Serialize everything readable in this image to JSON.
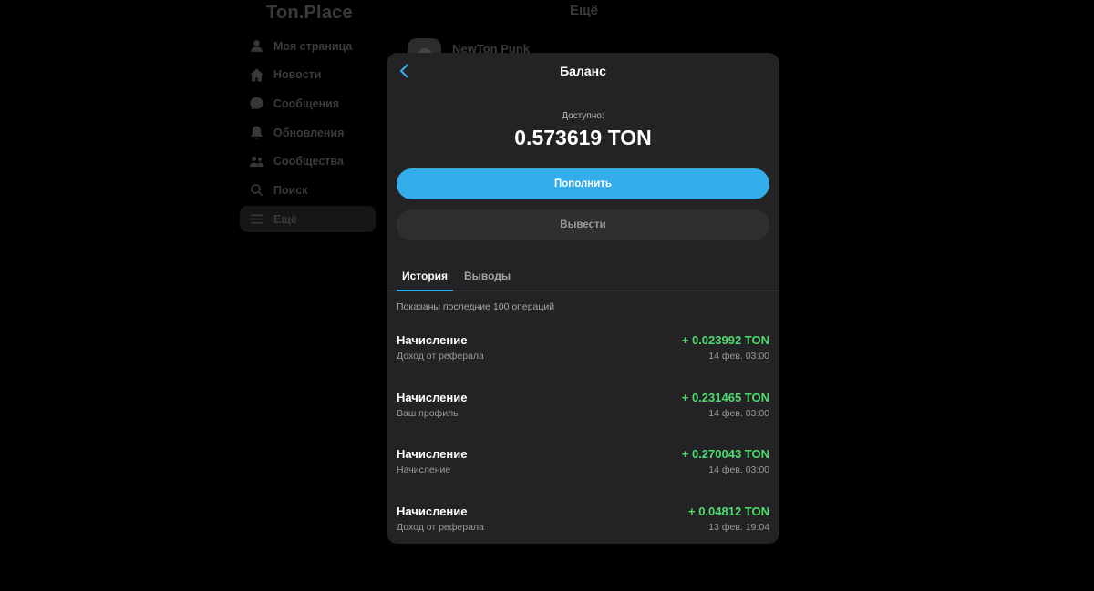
{
  "app": {
    "logo": "Ton.Place",
    "page_title": "Ещё"
  },
  "sidebar": {
    "items": [
      {
        "label": "Моя страница",
        "icon": "user-icon"
      },
      {
        "label": "Новости",
        "icon": "home-icon"
      },
      {
        "label": "Сообщения",
        "icon": "chat-icon"
      },
      {
        "label": "Обновления",
        "icon": "bell-icon"
      },
      {
        "label": "Сообщества",
        "icon": "community-icon"
      },
      {
        "label": "Поиск",
        "icon": "search-icon"
      },
      {
        "label": "Ещё",
        "icon": "menu-icon",
        "active": true
      }
    ]
  },
  "background_user": {
    "name": "NewTon Punk"
  },
  "modal": {
    "title": "Баланс",
    "available_label": "Доступно:",
    "balance": "0.573619 TON",
    "topup_label": "Пополнить",
    "withdraw_label": "Вывести",
    "tabs": [
      {
        "label": "История",
        "active": true
      },
      {
        "label": "Выводы",
        "active": false
      }
    ],
    "notice": "Показаны последние 100 операций",
    "transactions": [
      {
        "title": "Начисление",
        "subtitle": "Доход от реферала",
        "amount": "+ 0.023992 TON",
        "date": "14 фев. 03:00"
      },
      {
        "title": "Начисление",
        "subtitle": "Ваш профиль",
        "amount": "+ 0.231465 TON",
        "date": "14 фев. 03:00"
      },
      {
        "title": "Начисление",
        "subtitle": "Начисление",
        "amount": "+ 0.270043 TON",
        "date": "14 фев. 03:00"
      },
      {
        "title": "Начисление",
        "subtitle": "Доход от реферала",
        "amount": "+ 0.04812 TON",
        "date": "13 фев. 19:04"
      }
    ]
  },
  "colors": {
    "accent": "#33aeea",
    "positive": "#4fdc6f",
    "modal_bg": "#232325",
    "page_bg": "#000000"
  }
}
